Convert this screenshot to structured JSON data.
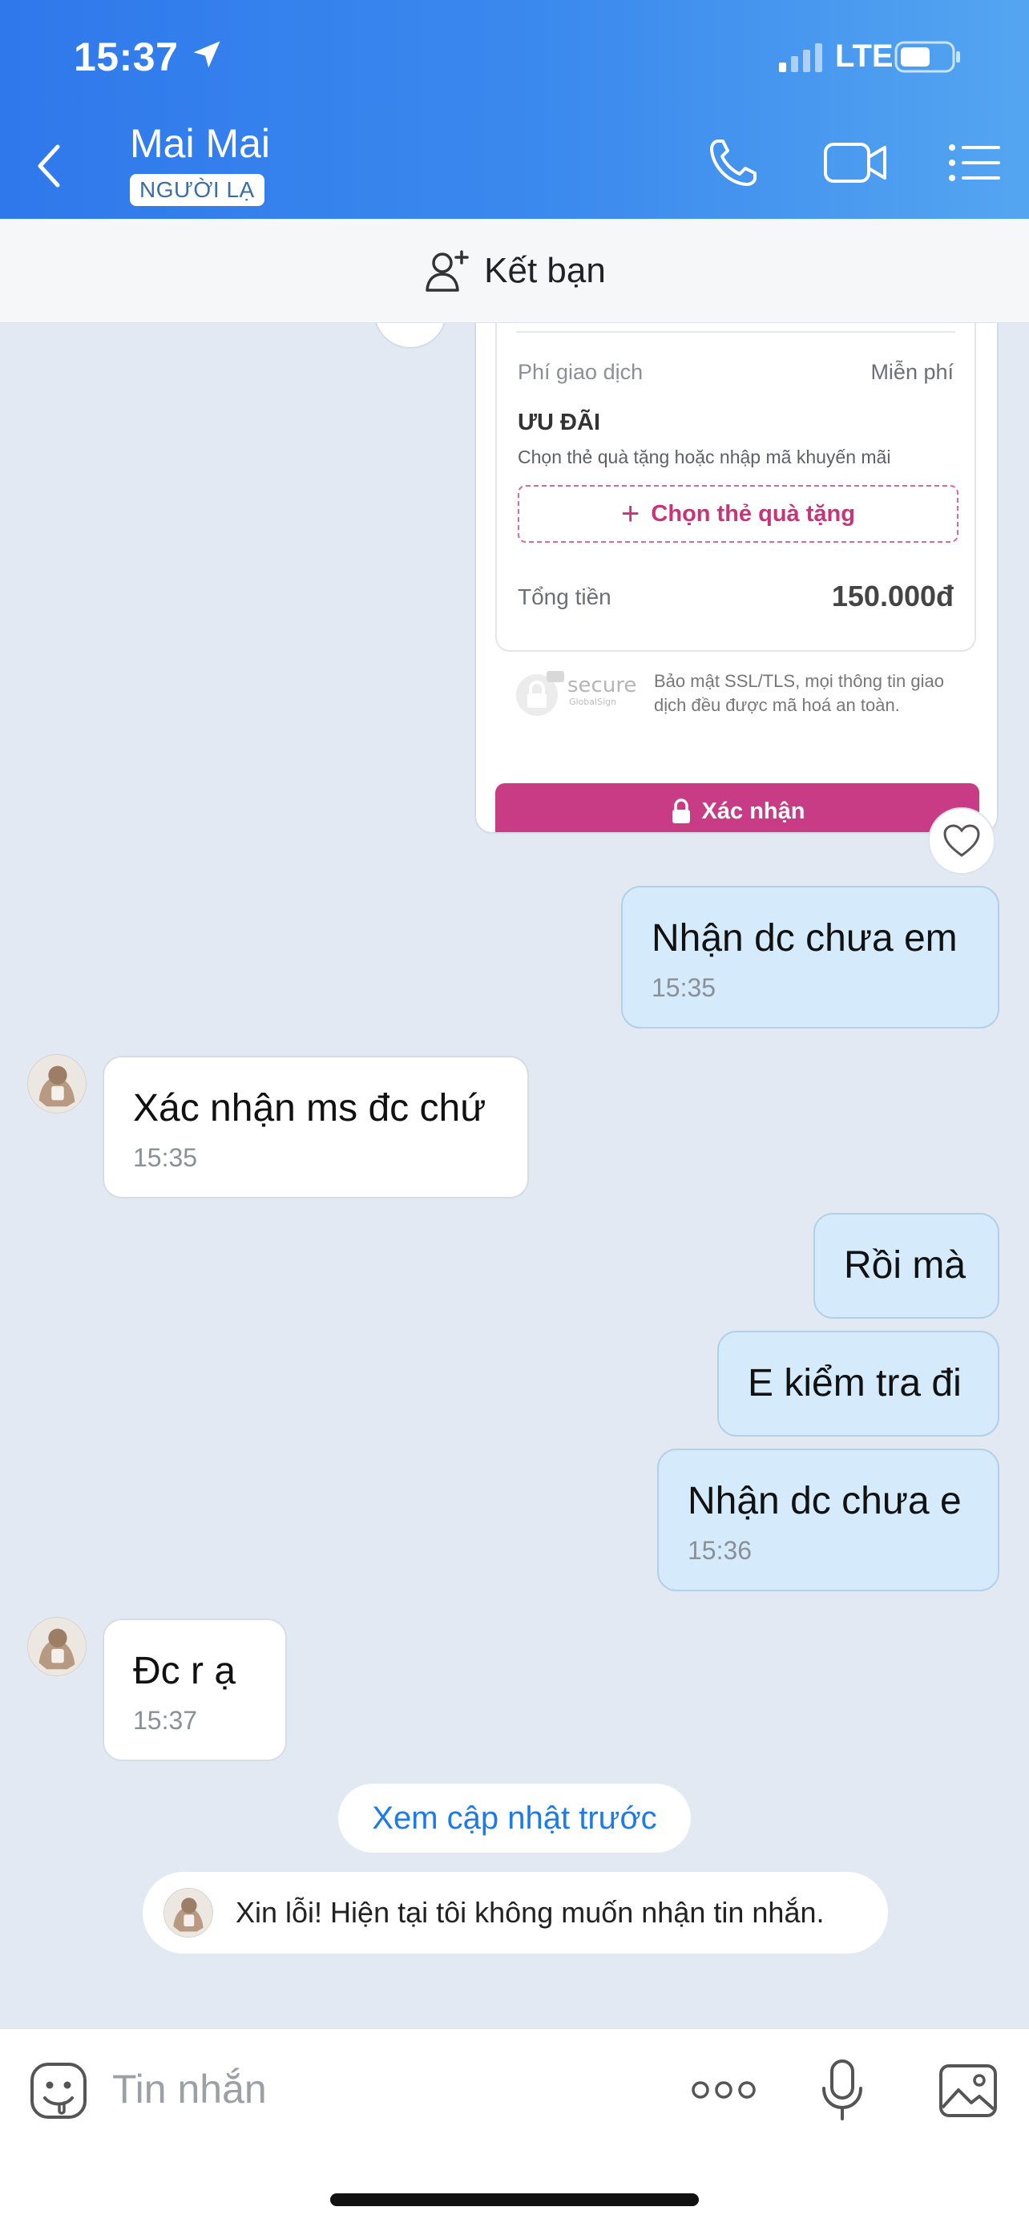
{
  "status_bar": {
    "time": "15:37",
    "network": "LTE"
  },
  "header": {
    "contact_name": "Mai Mai",
    "badge": "NGƯỜI LẠ",
    "icons": [
      "back-icon",
      "phone-icon",
      "video-call-icon",
      "menu-list-icon"
    ]
  },
  "friend_bar": {
    "label": "Kết bạn"
  },
  "screenshot": {
    "fee_label": "Phí giao dịch",
    "fee_value": "Miễn phí",
    "promo_title": "ƯU ĐÃI",
    "promo_sub": "Chọn thẻ quà tặng hoặc nhập mã khuyến mãi",
    "gift_button": "Chọn thẻ quà tặng",
    "total_label": "Tổng tiền",
    "total_value": "150.000đ",
    "secure_logo": "secure",
    "secure_sub": "GlobalSign",
    "secure_text": "Bảo mật SSL/TLS, mọi thông tin giao dịch đều được mã hoá an toàn.",
    "confirm_button": "Xác nhận"
  },
  "messages": [
    {
      "direction": "out",
      "text": "Nhận dc chưa em",
      "time": "15:35"
    },
    {
      "direction": "in",
      "text": "Xác nhận ms đc chứ",
      "time": "15:35"
    },
    {
      "direction": "out",
      "text": "Rồi mà"
    },
    {
      "direction": "out",
      "text": "E kiểm tra đi"
    },
    {
      "direction": "out",
      "text": "Nhận dc chưa e",
      "time": "15:36"
    },
    {
      "direction": "in",
      "text": "Đc r ạ",
      "time": "15:37"
    }
  ],
  "see_updates": "Xem cập nhật trước",
  "auto_reply": "Xin lỗi! Hiện tại tôi không muốn nhận tin nhắn.",
  "input_bar": {
    "placeholder": "Tin nhắn"
  },
  "colors": {
    "header_start": "#2f78ec",
    "header_end": "#54a5f1",
    "chat_bg": "#e2e9f2",
    "bubble_out": "#d5ebfc",
    "bubble_in": "#ffffff",
    "link_blue": "#1e7ae8",
    "pink_accent": "#c83c86"
  }
}
